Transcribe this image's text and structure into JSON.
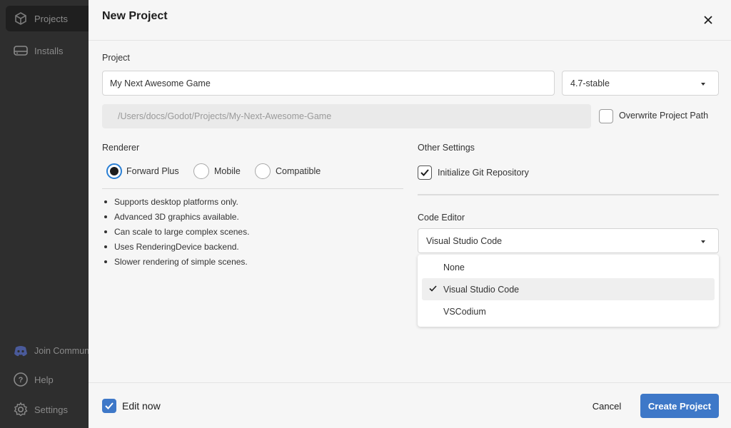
{
  "sidebar": {
    "items": [
      {
        "label": "Projects",
        "icon": "cube-icon"
      },
      {
        "label": "Installs",
        "icon": "drive-icon"
      },
      {
        "label": "Join Communi",
        "icon": "discord-icon"
      },
      {
        "label": "Help",
        "icon": "help-icon"
      },
      {
        "label": "Settings",
        "icon": "gear-icon"
      }
    ]
  },
  "modal": {
    "title": "New Project",
    "project_label": "Project",
    "project_name": "My Next Awesome Game",
    "version": "4.7-stable",
    "project_path": "/Users/docs/Godot/Projects/My-Next-Awesome-Game",
    "overwrite_label": "Overwrite Project Path",
    "renderer_label": "Renderer",
    "renderers": [
      "Forward Plus",
      "Mobile",
      "Compatible"
    ],
    "renderer_info": [
      "Supports desktop platforms only.",
      "Advanced 3D graphics available.",
      "Can scale to large complex scenes.",
      "Uses RenderingDevice backend.",
      "Slower rendering of simple scenes."
    ],
    "other_settings_label": "Other Settings",
    "git_label": "Initialize Git Repository",
    "code_editor_label": "Code Editor",
    "code_editor_value": "Visual Studio Code",
    "code_editor_options": [
      "None",
      "Visual Studio Code",
      "VSCodium"
    ],
    "edit_now_label": "Edit now",
    "cancel_label": "Cancel",
    "create_label": "Create Project"
  },
  "colors": {
    "accent": "#3e78c8",
    "radio_ring": "#2a7fd4"
  }
}
